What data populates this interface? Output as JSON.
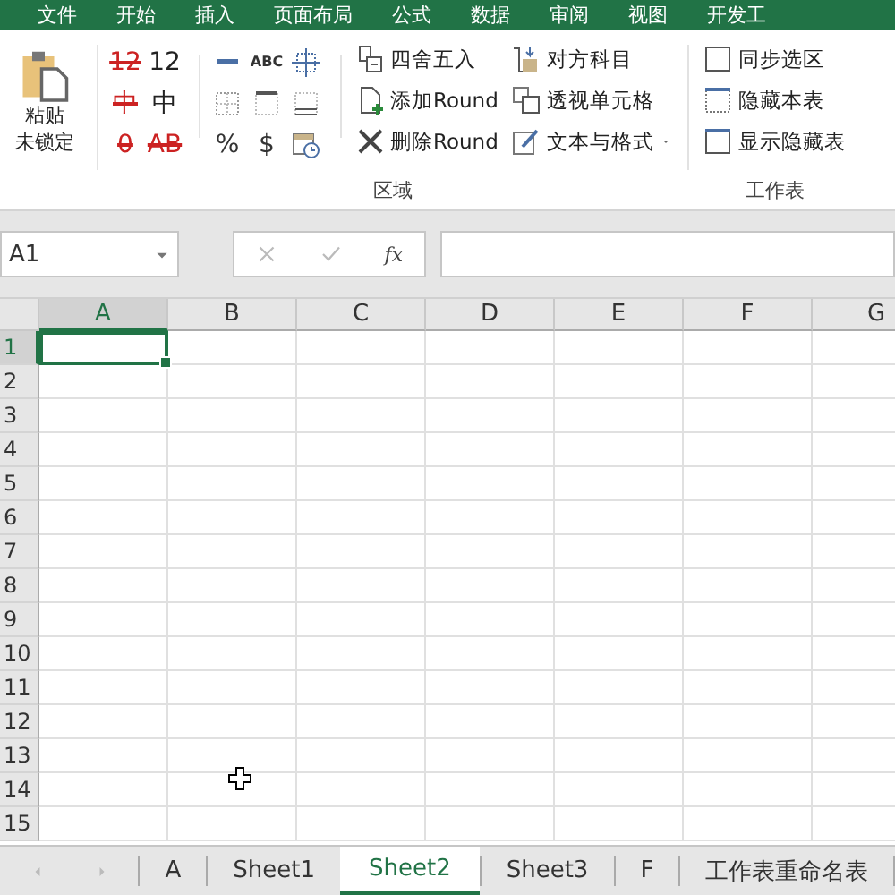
{
  "menu_tabs": [
    "文件",
    "开始",
    "插入",
    "页面布局",
    "公式",
    "数据",
    "审阅",
    "视图",
    "开发工"
  ],
  "ribbon": {
    "paste": {
      "label_lines": [
        "粘贴",
        "未锁定"
      ]
    },
    "glyphs": [
      {
        "text": "12",
        "kind": "crossed"
      },
      {
        "text": "12",
        "kind": "plain"
      },
      {
        "text": "中",
        "kind": "crossed"
      },
      {
        "text": "中",
        "kind": "plain"
      },
      {
        "text": "0",
        "kind": "crossed"
      },
      {
        "text": "AB",
        "kind": "crossed"
      }
    ],
    "format_symbols": [
      "ABC",
      "%",
      "$"
    ],
    "commands_a": [
      "四舍五入",
      "添加Round",
      "删除Round"
    ],
    "commands_b": [
      {
        "label": "对方科目",
        "dropdown": false
      },
      {
        "label": "透视单元格",
        "dropdown": false
      },
      {
        "label": "文本与格式",
        "dropdown": true
      }
    ],
    "commands_c": [
      "同步选区",
      "隐藏本表",
      "显示隐藏表"
    ],
    "group_labels": [
      "区域",
      "工作表"
    ]
  },
  "name_box": {
    "value": "A1"
  },
  "formula_bar": {
    "fx": "fx"
  },
  "columns": [
    {
      "label": "A",
      "selected": true
    },
    {
      "label": "B",
      "selected": false
    },
    {
      "label": "C",
      "selected": false
    },
    {
      "label": "D",
      "selected": false
    },
    {
      "label": "E",
      "selected": false
    },
    {
      "label": "F",
      "selected": false
    },
    {
      "label": "G",
      "selected": false
    }
  ],
  "rows": [
    {
      "label": "1",
      "selected": true
    },
    {
      "label": "2",
      "selected": false
    },
    {
      "label": "3",
      "selected": false
    },
    {
      "label": "4",
      "selected": false
    },
    {
      "label": "5",
      "selected": false
    },
    {
      "label": "6",
      "selected": false
    },
    {
      "label": "7",
      "selected": false
    },
    {
      "label": "8",
      "selected": false
    },
    {
      "label": "9",
      "selected": false
    },
    {
      "label": "10",
      "selected": false
    },
    {
      "label": "11",
      "selected": false
    },
    {
      "label": "12",
      "selected": false
    },
    {
      "label": "13",
      "selected": false
    },
    {
      "label": "14",
      "selected": false
    },
    {
      "label": "15",
      "selected": false
    }
  ],
  "sheet_tabs": [
    {
      "label": "A",
      "selected": false
    },
    {
      "label": "Sheet1",
      "selected": false
    },
    {
      "label": "Sheet2",
      "selected": true
    },
    {
      "label": "Sheet3",
      "selected": false
    },
    {
      "label": "F",
      "selected": false
    },
    {
      "label": "工作表重命名表",
      "selected": false
    }
  ]
}
